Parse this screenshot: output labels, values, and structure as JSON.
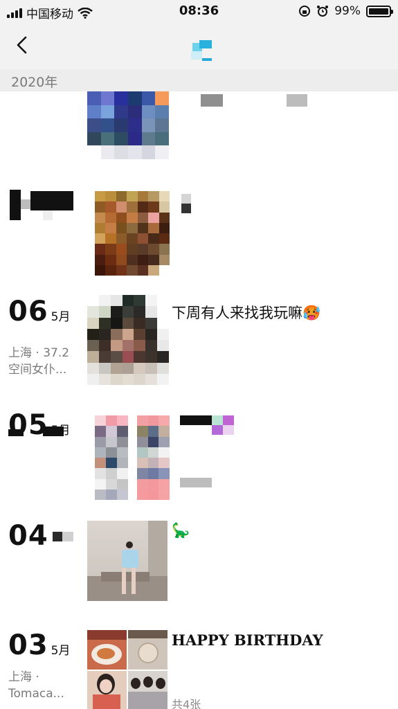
{
  "status": {
    "carrier": "中国移动",
    "time": "08:36",
    "battery": "99%",
    "battery_level": 0.99
  },
  "nav": {
    "back_icon": "chevron-left-icon"
  },
  "year_header": "2020年",
  "entries": [
    {
      "day": "06",
      "month": "5月",
      "location": "上海 · 37.2",
      "location2": "空间女仆...",
      "text": "下周有人来找我玩嘛🥵"
    },
    {
      "day": "05",
      "month": "5月"
    },
    {
      "day": "04",
      "text": "🦕"
    },
    {
      "day": "03",
      "month": "5月",
      "location": "上海 ·",
      "location2": "Tomaca...",
      "text": "HAPPY BIRTHDAY",
      "count": "共4张"
    }
  ],
  "colors": {
    "bar_bg": "#f2f2f2",
    "year_bg": "#ededed",
    "muted": "#7a7a7a"
  }
}
